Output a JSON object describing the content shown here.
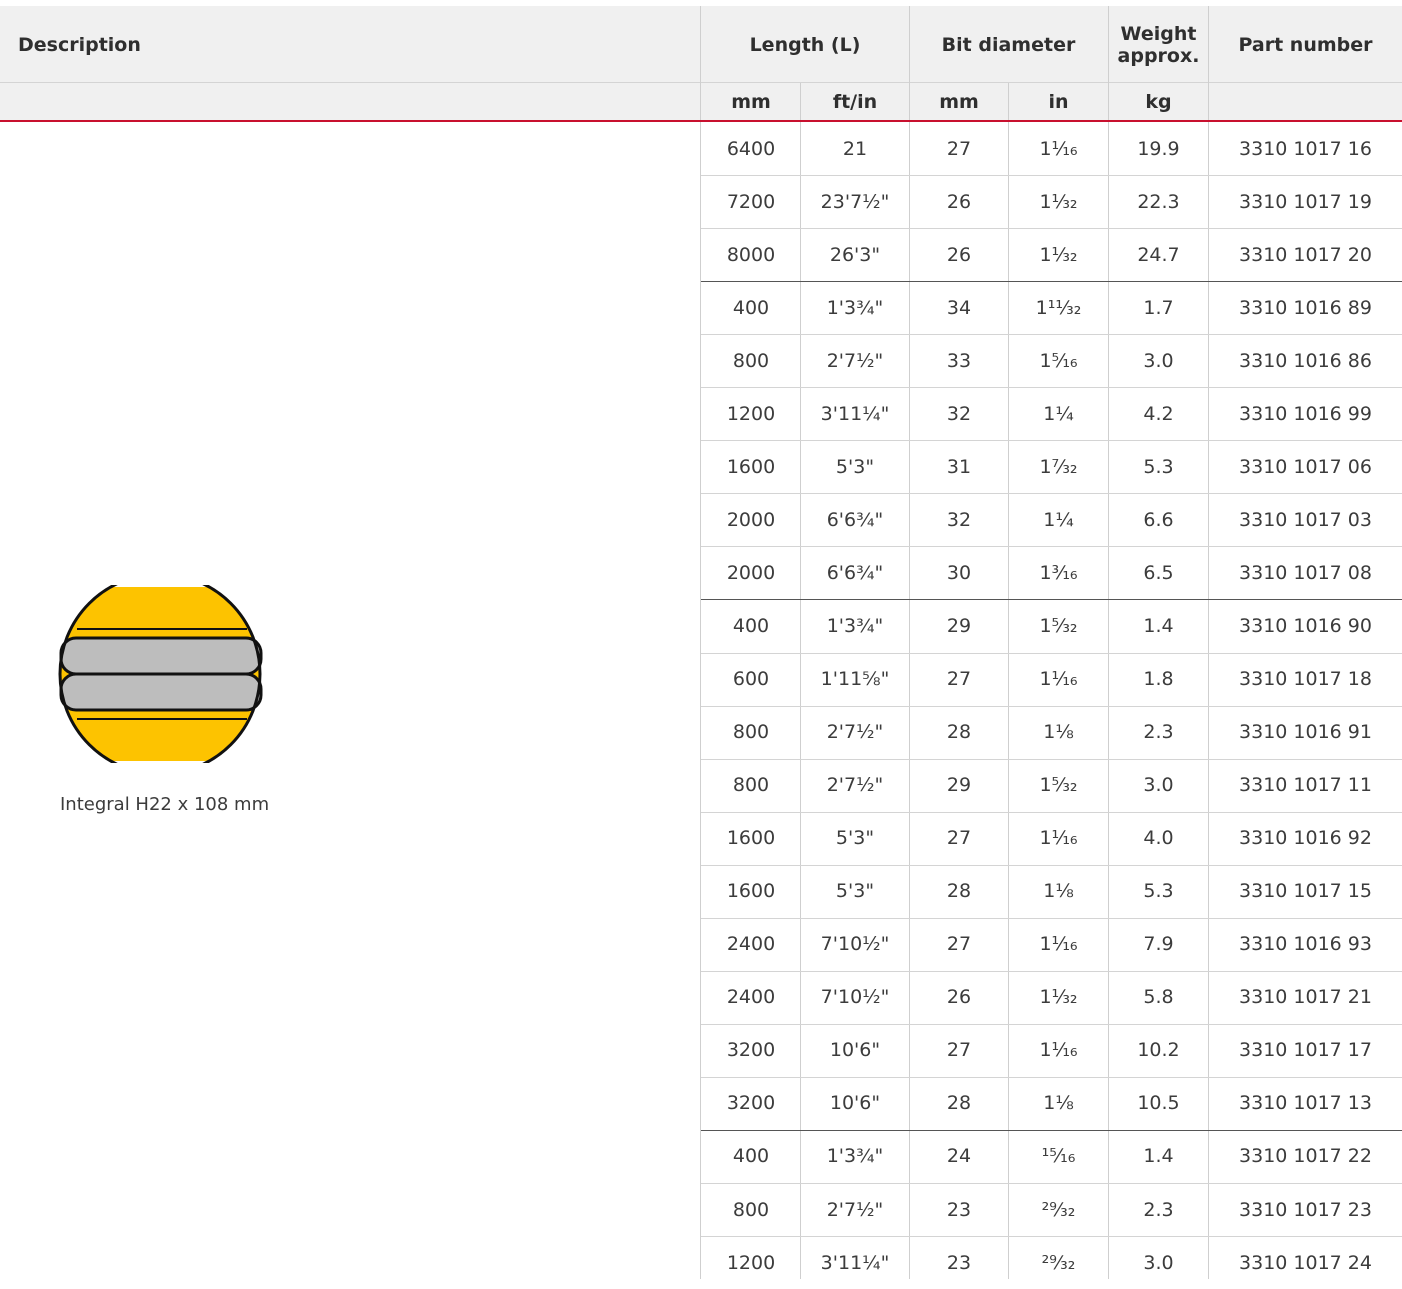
{
  "headers": {
    "description": "Description",
    "length": "Length (L)",
    "bit_diameter": "Bit diameter",
    "weight_line1": "Weight",
    "weight_line2": "approx.",
    "part_number": "Part number"
  },
  "units": [
    "mm",
    "ft/in",
    "mm",
    "in",
    "kg",
    ""
  ],
  "product": {
    "caption": "Integral H22 x 108 mm",
    "icon": "drill-rod-cross-section-icon",
    "colors": {
      "yellow": "#FDC300",
      "grey": "#BDBDBD",
      "outline": "#111111"
    }
  },
  "accent_color": "#C8102E",
  "rows": [
    [
      "6400",
      "21",
      "27",
      "1¹⁄₁₆",
      "19.9",
      "3310 1017 16"
    ],
    [
      "7200",
      "23'7½\"",
      "26",
      "1¹⁄₃₂",
      "22.3",
      "3310 1017 19"
    ],
    [
      "8000",
      "26'3\"",
      "26",
      "1¹⁄₃₂",
      "24.7",
      "3310 1017 20"
    ],
    [
      "400",
      "1'3¾\"",
      "34",
      "1¹¹⁄₃₂",
      "1.7",
      "3310 1016 89"
    ],
    [
      "800",
      "2'7½\"",
      "33",
      "1⁵⁄₁₆",
      "3.0",
      "3310 1016 86"
    ],
    [
      "1200",
      "3'11¼\"",
      "32",
      "1¼",
      "4.2",
      "3310 1016 99"
    ],
    [
      "1600",
      "5'3\"",
      "31",
      "1⁷⁄₃₂",
      "5.3",
      "3310 1017 06"
    ],
    [
      "2000",
      "6'6¾\"",
      "32",
      "1¼",
      "6.6",
      "3310 1017 03"
    ],
    [
      "2000",
      "6'6¾\"",
      "30",
      "1³⁄₁₆",
      "6.5",
      "3310 1017 08"
    ],
    [
      "400",
      "1'3¾\"",
      "29",
      "1⁵⁄₃₂",
      "1.4",
      "3310 1016 90"
    ],
    [
      "600",
      "1'11⅝\"",
      "27",
      "1¹⁄₁₆",
      "1.8",
      "3310 1017 18"
    ],
    [
      "800",
      "2'7½\"",
      "28",
      "1⅛",
      "2.3",
      "3310 1016 91"
    ],
    [
      "800",
      "2'7½\"",
      "29",
      "1⁵⁄₃₂",
      "3.0",
      "3310 1017 11"
    ],
    [
      "1600",
      "5'3\"",
      "27",
      "1¹⁄₁₆",
      "4.0",
      "3310 1016 92"
    ],
    [
      "1600",
      "5'3\"",
      "28",
      "1⅛",
      "5.3",
      "3310 1017 15"
    ],
    [
      "2400",
      "7'10½\"",
      "27",
      "1¹⁄₁₆",
      "7.9",
      "3310 1016 93"
    ],
    [
      "2400",
      "7'10½\"",
      "26",
      "1¹⁄₃₂",
      "5.8",
      "3310 1017 21"
    ],
    [
      "3200",
      "10'6\"",
      "27",
      "1¹⁄₁₆",
      "10.2",
      "3310 1017 17"
    ],
    [
      "3200",
      "10'6\"",
      "28",
      "1⅛",
      "10.5",
      "3310 1017 13"
    ],
    [
      "400",
      "1'3¾\"",
      "24",
      "¹⁵⁄₁₆",
      "1.4",
      "3310 1017 22"
    ],
    [
      "800",
      "2'7½\"",
      "23",
      "²⁹⁄₃₂",
      "2.3",
      "3310 1017 23"
    ],
    [
      "1200",
      "3'11¼\"",
      "23",
      "²⁹⁄₃₂",
      "3.0",
      "3310 1017 24"
    ]
  ]
}
